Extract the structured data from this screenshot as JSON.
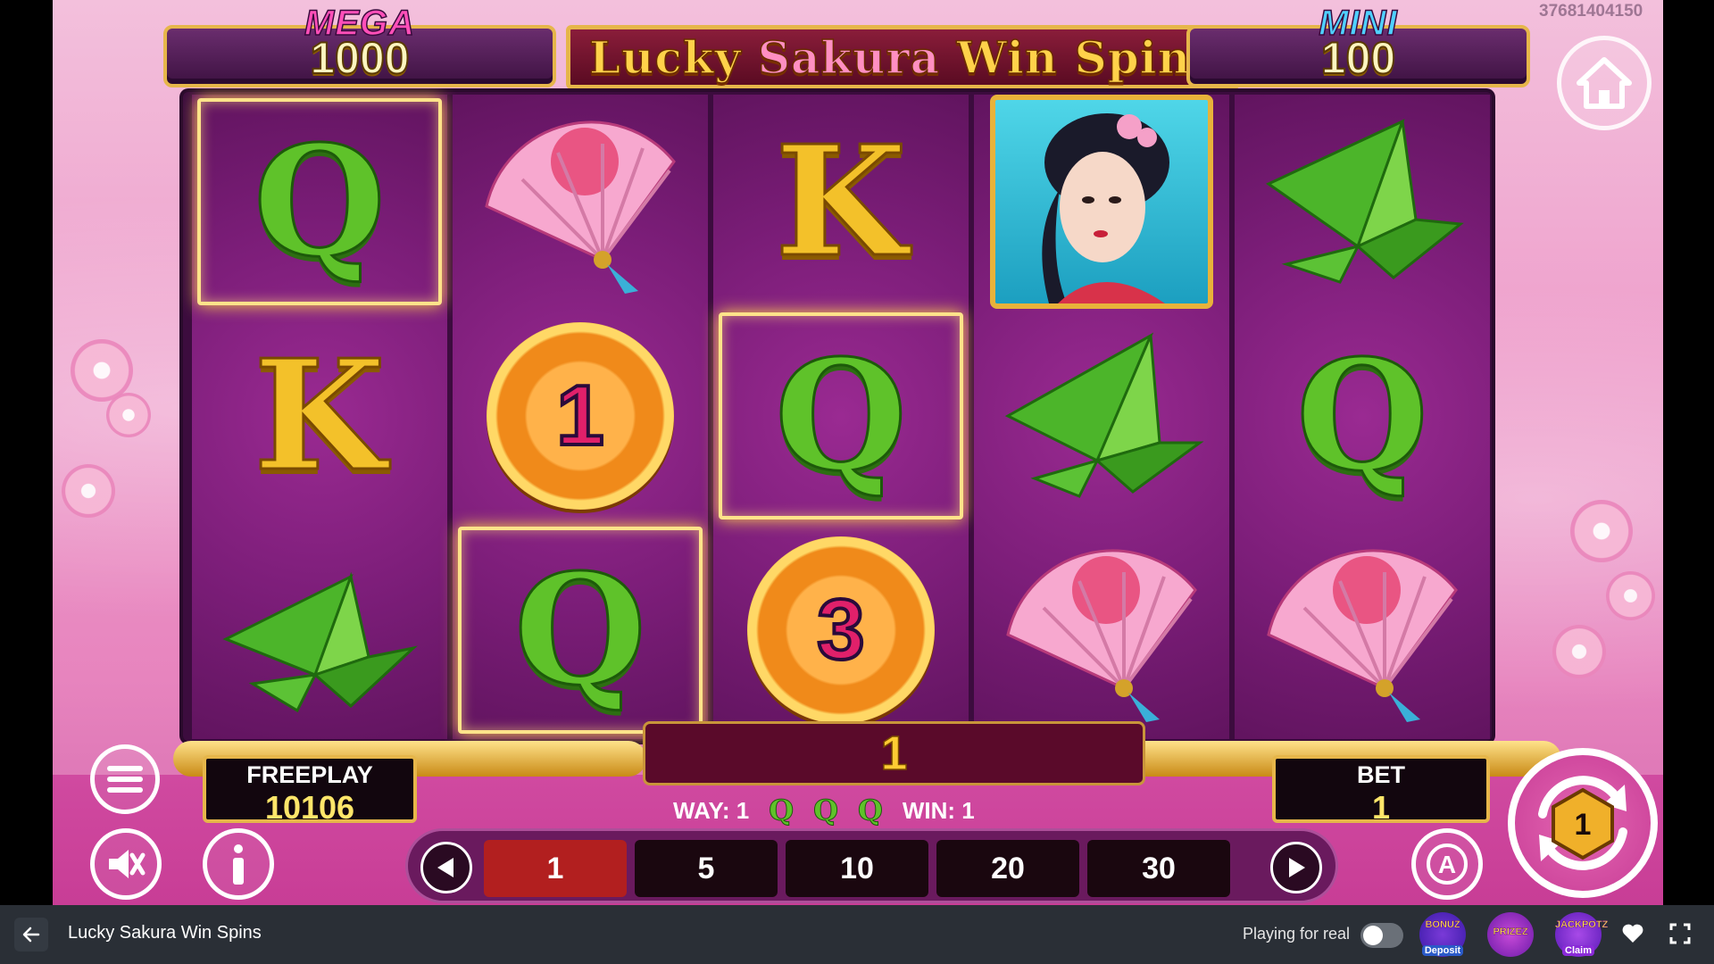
{
  "session_id": "37681404150",
  "jackpots": {
    "mega": {
      "title": "MEGA",
      "value": "1000",
      "color": "#ff4fb8"
    },
    "mini": {
      "title": "MINI",
      "value": "100",
      "color": "#4fd0ff"
    }
  },
  "game_title": {
    "part1": "Lucky ",
    "part2": "Sakura ",
    "part3": "Win Spins"
  },
  "reels": [
    [
      "Q",
      "K",
      "crane"
    ],
    [
      "fan",
      "coin",
      "Q"
    ],
    [
      "K",
      "Q",
      "coin"
    ],
    [
      "geisha",
      "crane",
      "fan"
    ],
    [
      "crane",
      "Q",
      "fan"
    ]
  ],
  "coins": {
    "reel2": "1",
    "reel3": "3"
  },
  "win_display": "1",
  "freeplay": {
    "label": "FREEPLAY",
    "value": "10106"
  },
  "bet": {
    "label": "BET",
    "value": "1"
  },
  "way_line": {
    "way_label": "WAY: 1",
    "symbols": [
      "Q",
      "Q",
      "Q"
    ],
    "win_label": "WIN: 1"
  },
  "bet_options": [
    "1",
    "5",
    "10",
    "20",
    "30"
  ],
  "selected_bet": "1",
  "spin_counter": "1",
  "site_bar": {
    "game_name": "Lucky Sakura Win Spins",
    "real_label": "Playing for real",
    "promos": [
      {
        "name": "BONUZ",
        "sub": "Deposit"
      },
      {
        "name": "PRIZEZ",
        "sub": ""
      },
      {
        "name": "JACKPOTZ",
        "sub": "Claim"
      }
    ]
  },
  "icons": [
    "home-icon",
    "menu-icon",
    "sound-off-icon",
    "info-icon",
    "autoplay-icon",
    "spin-icon",
    "arrow-left-icon",
    "arrow-right-icon",
    "back-arrow-icon",
    "heart-icon",
    "fullscreen-icon"
  ]
}
